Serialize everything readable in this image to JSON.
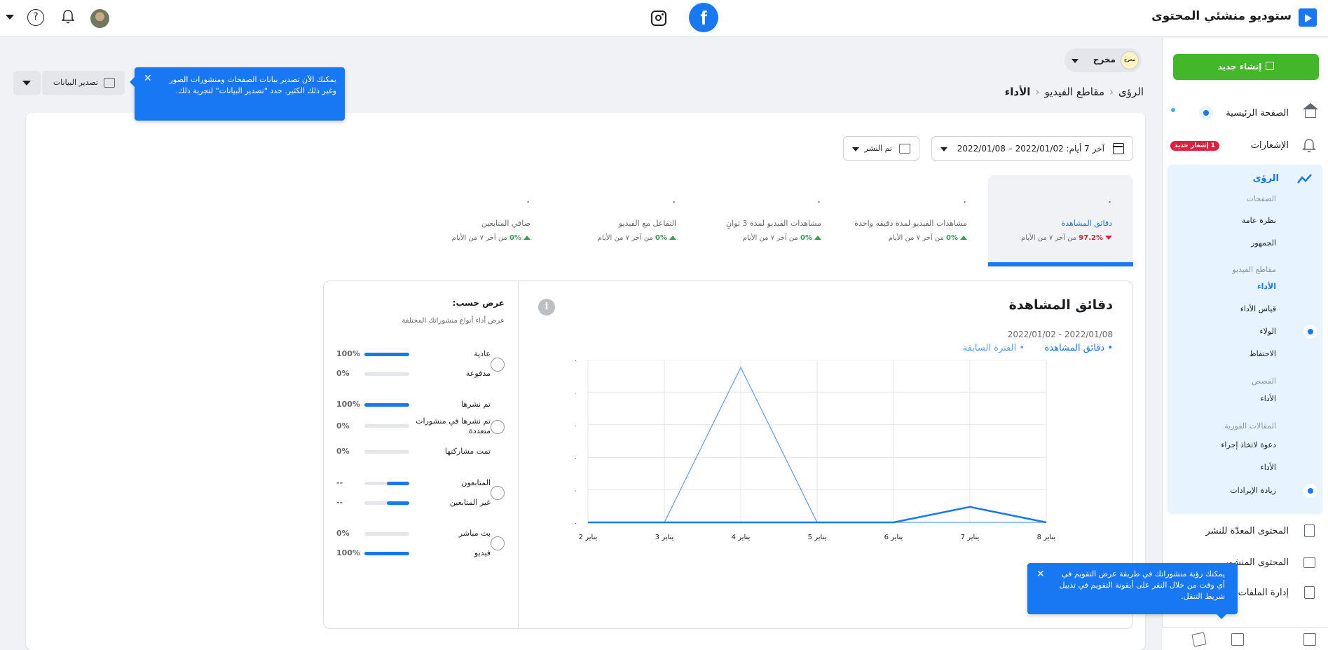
{
  "app": {
    "title": "ستوديو منشئي المحتوى"
  },
  "header_icons": [
    "facebook-icon",
    "instagram-icon",
    "bell-icon",
    "help-icon",
    "avatar"
  ],
  "sidebar": {
    "create_label": "إنشاء جديد",
    "home": "الصفحة الرئيسية",
    "notifications": "الإشعارات",
    "notif_badge": "1 إشعار جديد",
    "insights": "الرؤى",
    "groups": [
      {
        "heading": "الصفحات",
        "items": [
          "نظرة عامة",
          "الجمهور"
        ]
      },
      {
        "heading": "مقاطع الفيديو",
        "items": [
          "الأداء",
          "قياس الأداء",
          "الولاء",
          "الاحتفاظ"
        ]
      },
      {
        "heading": "القصص",
        "items": [
          "الأداء"
        ]
      },
      {
        "heading": "المقالات الفورية",
        "items": [
          "دعوة لاتخاذ إجراء",
          "الأداء"
        ]
      },
      {
        "heading": "",
        "items": [
          "زيادة الإيرادات"
        ]
      }
    ],
    "drafts": "المحتوى المعدّة للنشر",
    "published": "المحتوى المنشور",
    "files": "إدارة الملفات"
  },
  "page_switch": {
    "name": "مخرج",
    "avatar_text": "مخرج"
  },
  "breadcrumb": [
    "الرؤى",
    "مقاطع الفيديو",
    "الأداء"
  ],
  "export": {
    "label": "تصدير البيانات"
  },
  "tooltips": {
    "export_tip": "يمكنك الآن تصدير بيانات الصفحات ومنشورات الصور وغير ذلك الكثير. حدد \"تصدير البيانات\" لتجربة ذلك.",
    "sidebar_tip": "يمكنك رؤية منشوراتك في طريقة عرض التقويم في أي وقت من خلال النقر على أيقونة التقويم في تذييل شريط التنقل."
  },
  "filters": {
    "date_range": "آخر 7 أيام: 2022/01/02 – 2022/01/08",
    "publish": "تم النشر"
  },
  "metrics": [
    {
      "name": "دقائق المشاهدة",
      "value": "٠",
      "change": "97.2%",
      "direction": "down",
      "suffix": "من آخر ٧ من الأيام"
    },
    {
      "name": "مشاهدات الفيديو لمدة دقيقة واحدة",
      "value": "٠",
      "change": "0%",
      "direction": "up",
      "suffix": "من آخر ٧ من الأيام"
    },
    {
      "name": "مشاهدات الفيديو لمدة 3 ثوانٍ",
      "value": "٠",
      "change": "0%",
      "direction": "up",
      "suffix": "من آخر ٧ من الأيام"
    },
    {
      "name": "التفاعل مع الفيديو",
      "value": "٠",
      "change": "0%",
      "direction": "up",
      "suffix": "من آخر ٧ من الأيام"
    },
    {
      "name": "صافي المتابعين",
      "value": "٠",
      "change": "0%",
      "direction": "up",
      "suffix": "من آخر ٧ من الأيام"
    }
  ],
  "chart_panel": {
    "title": "دقائق المشاهدة",
    "range": "2022/01/02 - 2022/01/08",
    "legend_main": "دقائق المشاهدة",
    "legend_prev": "الفترة السابقة"
  },
  "chart_data": {
    "type": "line",
    "x": [
      "يناير 2",
      "يناير 3",
      "يناير 4",
      "يناير 5",
      "يناير 6",
      "يناير 7",
      "يناير 8"
    ],
    "y_ticks": [
      "٠",
      "٠",
      "٠",
      "٠",
      "٠",
      "٠"
    ],
    "series": [
      {
        "name": "دقائق المشاهدة",
        "values": [
          0,
          0,
          0,
          0,
          0,
          0.1,
          0
        ],
        "color": "#1877f2"
      },
      {
        "name": "الفترة السابقة",
        "values": [
          0,
          0,
          1,
          0,
          0,
          0,
          0
        ],
        "color": "#5b9cf3"
      }
    ],
    "ylim": [
      0,
      1.05
    ],
    "grid": true,
    "legend": "top-right"
  },
  "view_by": {
    "title": "عرض حسب:",
    "subtitle": "عرض أداء أنواع منشوراتك المختلفة",
    "groups": [
      {
        "rows": [
          {
            "label": "عادية",
            "pct": "100%",
            "fill": 1.0
          },
          {
            "label": "مدفوعة",
            "pct": "0%",
            "fill": 0
          }
        ]
      },
      {
        "rows": [
          {
            "label": "تم نشرها",
            "pct": "100%",
            "fill": 1.0
          },
          {
            "label": "تم نشرها في منشورات متعددة",
            "pct": "0%",
            "fill": 0
          },
          {
            "label": "تمت مشاركتها",
            "pct": "0%",
            "fill": 0
          }
        ]
      },
      {
        "rows": [
          {
            "label": "المتابعون",
            "pct": "--",
            "fill": 0.5
          },
          {
            "label": "غير المتابعين",
            "pct": "--",
            "fill": 0.5
          }
        ]
      },
      {
        "rows": [
          {
            "label": "بث مباشر",
            "pct": "0%",
            "fill": 0
          },
          {
            "label": "فيديو",
            "pct": "100%",
            "fill": 1.0
          }
        ]
      }
    ]
  }
}
